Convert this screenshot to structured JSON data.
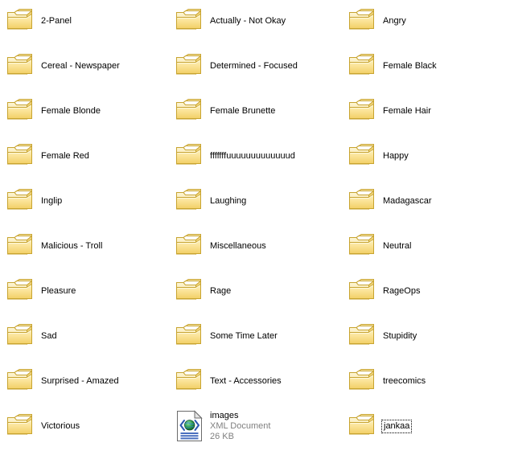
{
  "view": {
    "name": "file-explorer-tiles-view",
    "background_color": "#ffffff",
    "columns": 3,
    "rows": 10,
    "column_x": [
      4,
      214,
      429
    ],
    "row_y": [
      2,
      58,
      114,
      170,
      226,
      282,
      338,
      394,
      450,
      506
    ],
    "label_color": "#000000",
    "meta_color": "#808080",
    "folder_color": "#fbe38d",
    "folder_border_color": "#c9a227",
    "xml_accent_color": "#2b56b0"
  },
  "items": [
    {
      "name": "2-Panel",
      "icon": "folder-icon",
      "type": "folder",
      "col": 0,
      "row": 0,
      "focused": false
    },
    {
      "name": "Actually - Not Okay",
      "icon": "folder-icon",
      "type": "folder",
      "col": 1,
      "row": 0,
      "focused": false
    },
    {
      "name": "Angry",
      "icon": "folder-icon",
      "type": "folder",
      "col": 2,
      "row": 0,
      "focused": false
    },
    {
      "name": "Cereal - Newspaper",
      "icon": "folder-icon",
      "type": "folder",
      "col": 0,
      "row": 1,
      "focused": false
    },
    {
      "name": "Determined - Focused",
      "icon": "folder-icon",
      "type": "folder",
      "col": 1,
      "row": 1,
      "focused": false
    },
    {
      "name": "Female Black",
      "icon": "folder-icon",
      "type": "folder",
      "col": 2,
      "row": 1,
      "focused": false
    },
    {
      "name": "Female Blonde",
      "icon": "folder-icon",
      "type": "folder",
      "col": 0,
      "row": 2,
      "focused": false
    },
    {
      "name": "Female Brunette",
      "icon": "folder-icon",
      "type": "folder",
      "col": 1,
      "row": 2,
      "focused": false
    },
    {
      "name": "Female Hair",
      "icon": "folder-icon",
      "type": "folder",
      "col": 2,
      "row": 2,
      "focused": false
    },
    {
      "name": "Female Red",
      "icon": "folder-icon",
      "type": "folder",
      "col": 0,
      "row": 3,
      "focused": false
    },
    {
      "name": "fffffffuuuuuuuuuuuuud",
      "icon": "folder-icon",
      "type": "folder",
      "col": 1,
      "row": 3,
      "focused": false
    },
    {
      "name": "Happy",
      "icon": "folder-icon",
      "type": "folder",
      "col": 2,
      "row": 3,
      "focused": false
    },
    {
      "name": "Inglip",
      "icon": "folder-icon",
      "type": "folder",
      "col": 0,
      "row": 4,
      "focused": false
    },
    {
      "name": "Laughing",
      "icon": "folder-icon",
      "type": "folder",
      "col": 1,
      "row": 4,
      "focused": false
    },
    {
      "name": "Madagascar",
      "icon": "folder-icon",
      "type": "folder",
      "col": 2,
      "row": 4,
      "focused": false
    },
    {
      "name": "Malicious - Troll",
      "icon": "folder-icon",
      "type": "folder",
      "col": 0,
      "row": 5,
      "focused": false
    },
    {
      "name": "Miscellaneous",
      "icon": "folder-icon",
      "type": "folder",
      "col": 1,
      "row": 5,
      "focused": false
    },
    {
      "name": "Neutral",
      "icon": "folder-icon",
      "type": "folder",
      "col": 2,
      "row": 5,
      "focused": false
    },
    {
      "name": "Pleasure",
      "icon": "folder-icon",
      "type": "folder",
      "col": 0,
      "row": 6,
      "focused": false
    },
    {
      "name": "Rage",
      "icon": "folder-icon",
      "type": "folder",
      "col": 1,
      "row": 6,
      "focused": false
    },
    {
      "name": "RageOps",
      "icon": "folder-icon",
      "type": "folder",
      "col": 2,
      "row": 6,
      "focused": false
    },
    {
      "name": "Sad",
      "icon": "folder-icon",
      "type": "folder",
      "col": 0,
      "row": 7,
      "focused": false
    },
    {
      "name": "Some Time Later",
      "icon": "folder-icon",
      "type": "folder",
      "col": 1,
      "row": 7,
      "focused": false
    },
    {
      "name": "Stupidity",
      "icon": "folder-icon",
      "type": "folder",
      "col": 2,
      "row": 7,
      "focused": false
    },
    {
      "name": "Surprised - Amazed",
      "icon": "folder-icon",
      "type": "folder",
      "col": 0,
      "row": 8,
      "focused": false
    },
    {
      "name": "Text - Accessories",
      "icon": "folder-icon",
      "type": "folder",
      "col": 1,
      "row": 8,
      "focused": false
    },
    {
      "name": "treecomics",
      "icon": "folder-icon",
      "type": "folder",
      "col": 2,
      "row": 8,
      "focused": false
    },
    {
      "name": "Victorious",
      "icon": "folder-icon",
      "type": "folder",
      "col": 0,
      "row": 9,
      "focused": false
    },
    {
      "name": "images",
      "icon": "xml-document-icon",
      "type": "file",
      "file_type": "XML Document",
      "file_size": "26 KB",
      "col": 1,
      "row": 9,
      "focused": false
    },
    {
      "name": "jankaa",
      "icon": "folder-icon",
      "type": "folder",
      "col": 2,
      "row": 9,
      "focused": true
    }
  ]
}
